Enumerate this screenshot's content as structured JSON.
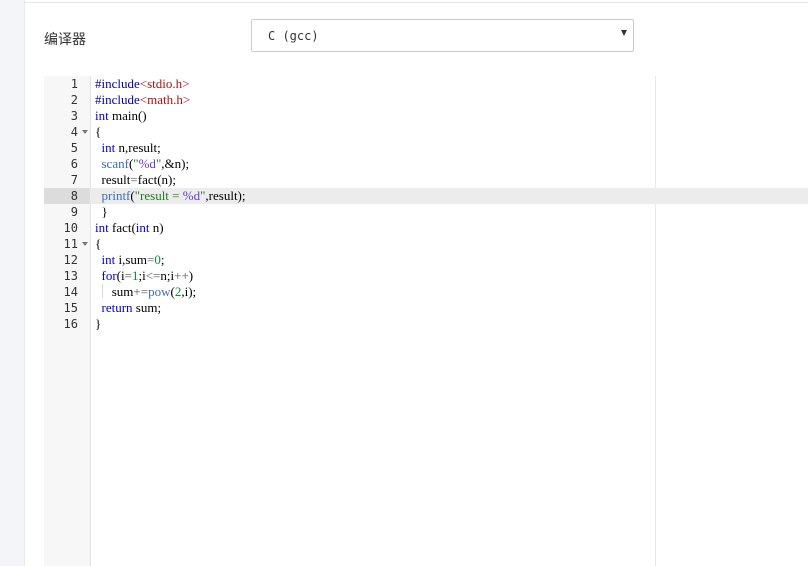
{
  "settings": {
    "compiler_label": "编译器",
    "compiler_selected": "C (gcc)"
  },
  "editor": {
    "lines": [
      {
        "n": "1",
        "code": "#include<stdio.h>"
      },
      {
        "n": "2",
        "code": "#include<math.h>"
      },
      {
        "n": "3",
        "code": "int main()"
      },
      {
        "n": "4",
        "code": "{"
      },
      {
        "n": "5",
        "code": "  int n,result;"
      },
      {
        "n": "6",
        "code": "  scanf(\"%d\",&n);"
      },
      {
        "n": "7",
        "code": "  result=fact(n);"
      },
      {
        "n": "8",
        "code": "  printf(\"result = %d\",result);"
      },
      {
        "n": "9",
        "code": "  }"
      },
      {
        "n": "10",
        "code": "int fact(int n)"
      },
      {
        "n": "11",
        "code": "{"
      },
      {
        "n": "12",
        "code": "  int i,sum=0;"
      },
      {
        "n": "13",
        "code": "  for(i=1;i<=n;i++)"
      },
      {
        "n": "14",
        "code": "    sum+=pow(2,i);"
      },
      {
        "n": "15",
        "code": "  return sum;"
      },
      {
        "n": "16",
        "code": "}"
      }
    ],
    "active_line": "8"
  }
}
